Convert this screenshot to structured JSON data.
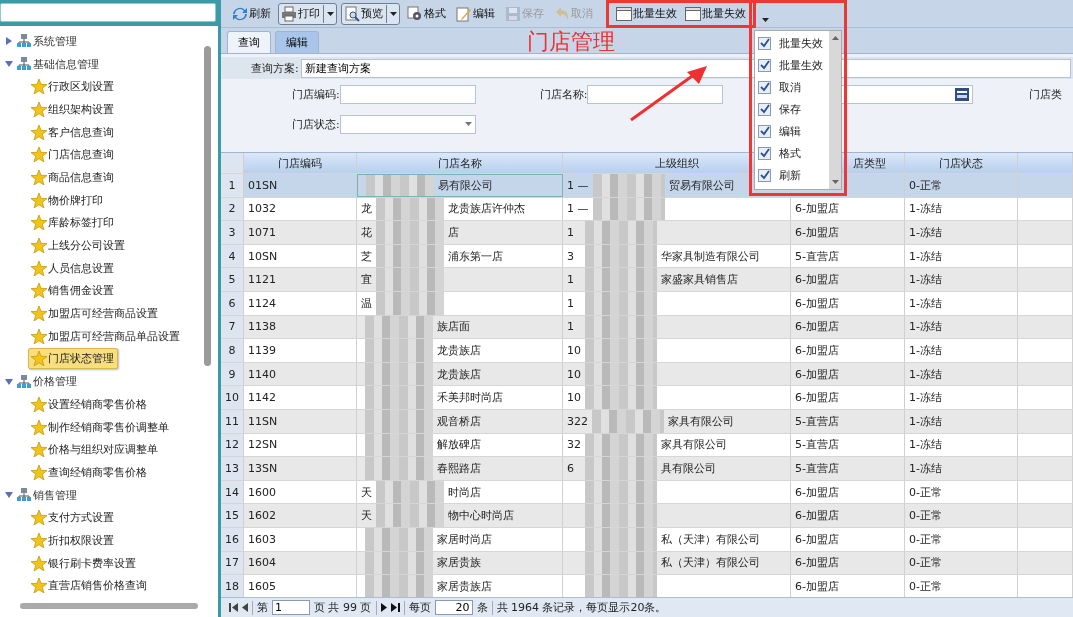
{
  "sidebar": {
    "tree": [
      {
        "label": "系统管理",
        "expanded": false
      },
      {
        "label": "基础信息管理",
        "expanded": true,
        "children": [
          {
            "label": "行政区划设置",
            "selected": false
          },
          {
            "label": "组织架构设置",
            "selected": false
          },
          {
            "label": "客户信息查询",
            "selected": false
          },
          {
            "label": "门店信息查询",
            "selected": false
          },
          {
            "label": "商品信息查询",
            "selected": false
          },
          {
            "label": "物价牌打印",
            "selected": false
          },
          {
            "label": "库龄标签打印",
            "selected": false
          },
          {
            "label": "上线分公司设置",
            "selected": false
          },
          {
            "label": "人员信息设置",
            "selected": false
          },
          {
            "label": "销售佣金设置",
            "selected": false
          },
          {
            "label": "加盟店可经营商品设置",
            "selected": false
          },
          {
            "label": "加盟店可经营商品单品设置",
            "selected": false
          },
          {
            "label": "门店状态管理",
            "selected": true
          }
        ]
      },
      {
        "label": "价格管理",
        "expanded": true,
        "children": [
          {
            "label": "设置经销商零售价格",
            "selected": false
          },
          {
            "label": "制作经销商零售价调整单",
            "selected": false
          },
          {
            "label": "价格与组织对应调整单",
            "selected": false
          },
          {
            "label": "查询经销商零售价格",
            "selected": false
          }
        ]
      },
      {
        "label": "销售管理",
        "expanded": true,
        "children": [
          {
            "label": "支付方式设置",
            "selected": false
          },
          {
            "label": "折扣权限设置",
            "selected": false
          },
          {
            "label": "银行刷卡费率设置",
            "selected": false
          },
          {
            "label": "直营店销售价格查询",
            "selected": false
          }
        ]
      }
    ]
  },
  "toolbar": [
    {
      "label": "刷新",
      "kind": "refresh",
      "disabled": false
    },
    {
      "label": "打印",
      "kind": "print",
      "disabled": false
    },
    {
      "label": "预览",
      "kind": "preview",
      "disabled": false
    },
    {
      "label": "格式",
      "kind": "format",
      "disabled": false
    },
    {
      "label": "编辑",
      "kind": "edit",
      "disabled": false
    },
    {
      "label": "保存",
      "kind": "save",
      "disabled": true
    },
    {
      "label": "取消",
      "kind": "cancel",
      "disabled": true
    },
    {
      "label": "批量生效",
      "kind": "batch",
      "disabled": false
    },
    {
      "label": "批量失效",
      "kind": "batch",
      "disabled": false
    }
  ],
  "overflow_menu": [
    {
      "label": "批量失效",
      "checked": true
    },
    {
      "label": "批量生效",
      "checked": true
    },
    {
      "label": "取消",
      "checked": true
    },
    {
      "label": "保存",
      "checked": true
    },
    {
      "label": "编辑",
      "checked": true
    },
    {
      "label": "格式",
      "checked": true
    },
    {
      "label": "刷新",
      "checked": true
    }
  ],
  "tabs": [
    {
      "label": "查询",
      "selected": false
    },
    {
      "label": "编辑",
      "selected": true
    }
  ],
  "query": {
    "scheme_label": "查询方案:",
    "scheme_value": "新建查询方案",
    "code_label": "门店编码:",
    "name_label": "门店名称:",
    "cut_label": "门店类",
    "status_label": "门店状态:"
  },
  "annotation": "门店管理",
  "table": {
    "columns": [
      "门店编码",
      "门店名称",
      "上级组织",
      "店类型",
      "门店状态"
    ],
    "rows": [
      {
        "num": "1",
        "code": "01SN",
        "name_head": "",
        "name_tail": "易有限公司",
        "org_head": "1 —",
        "org_tail": "贸易有限公司",
        "type": "",
        "status": "0-正常",
        "selected": true
      },
      {
        "num": "2",
        "code": "1032",
        "name_head": "龙",
        "name_tail": "龙贵族店许仲杰",
        "org_head": "1 —",
        "org_tail": "",
        "type": "6-加盟店",
        "status": "1-冻结",
        "selected": false
      },
      {
        "num": "3",
        "code": "1071",
        "name_head": "花",
        "name_tail": "店",
        "org_head": "1",
        "org_tail": "",
        "type": "6-加盟店",
        "status": "1-冻结",
        "selected": false
      },
      {
        "num": "4",
        "code": "10SN",
        "name_head": "芝",
        "name_tail": "浦东第一店",
        "org_head": "3",
        "org_tail": "华家具制造有限公司",
        "type": "5-直营店",
        "status": "1-冻结",
        "selected": false
      },
      {
        "num": "5",
        "code": "1121",
        "name_head": "宜",
        "name_tail": "",
        "org_head": "1",
        "org_tail": "家盛家具销售店",
        "type": "6-加盟店",
        "status": "1-冻结",
        "selected": false
      },
      {
        "num": "6",
        "code": "1124",
        "name_head": "温",
        "name_tail": "",
        "org_head": "1",
        "org_tail": "",
        "type": "6-加盟店",
        "status": "1-冻结",
        "selected": false
      },
      {
        "num": "7",
        "code": "1138",
        "name_head": "",
        "name_tail": "族店面",
        "org_head": "1",
        "org_tail": "",
        "type": "6-加盟店",
        "status": "1-冻结",
        "selected": false
      },
      {
        "num": "8",
        "code": "1139",
        "name_head": "",
        "name_tail": "龙贵族店",
        "org_head": "10",
        "org_tail": "",
        "type": "6-加盟店",
        "status": "1-冻结",
        "selected": false
      },
      {
        "num": "9",
        "code": "1140",
        "name_head": "",
        "name_tail": "龙贵族店",
        "org_head": "10",
        "org_tail": "",
        "type": "6-加盟店",
        "status": "1-冻结",
        "selected": false
      },
      {
        "num": "10",
        "code": "1142",
        "name_head": "",
        "name_tail": "禾美邦时尚店",
        "org_head": "10",
        "org_tail": "",
        "type": "6-加盟店",
        "status": "1-冻结",
        "selected": false
      },
      {
        "num": "11",
        "code": "11SN",
        "name_head": "",
        "name_tail": "观音桥店",
        "org_head": "322",
        "org_tail": "家具有限公司",
        "type": "5-直营店",
        "status": "1-冻结",
        "selected": false
      },
      {
        "num": "12",
        "code": "12SN",
        "name_head": "",
        "name_tail": "解放碑店",
        "org_head": "32",
        "org_tail": "家具有限公司",
        "type": "5-直营店",
        "status": "1-冻结",
        "selected": false
      },
      {
        "num": "13",
        "code": "13SN",
        "name_head": "",
        "name_tail": "春熙路店",
        "org_head": "6",
        "org_tail": "具有限公司",
        "type": "5-直营店",
        "status": "1-冻结",
        "selected": false
      },
      {
        "num": "14",
        "code": "1600",
        "name_head": "天",
        "name_tail": "时尚店",
        "org_head": "",
        "org_tail": "",
        "type": "6-加盟店",
        "status": "0-正常",
        "selected": false
      },
      {
        "num": "15",
        "code": "1602",
        "name_head": "天",
        "name_tail": "物中心时尚店",
        "org_head": "",
        "org_tail": "",
        "type": "6-加盟店",
        "status": "0-正常",
        "selected": false
      },
      {
        "num": "16",
        "code": "1603",
        "name_head": "",
        "name_tail": "家居时尚店",
        "org_head": "",
        "org_tail": "私（天津）有限公司",
        "type": "6-加盟店",
        "status": "0-正常",
        "selected": false
      },
      {
        "num": "17",
        "code": "1604",
        "name_head": "",
        "name_tail": "家居贵族",
        "org_head": "",
        "org_tail": "私（天津）有限公司",
        "type": "6-加盟店",
        "status": "0-正常",
        "selected": false
      },
      {
        "num": "18",
        "code": "1605",
        "name_head": "",
        "name_tail": "家居贵族店",
        "org_head": "",
        "org_tail": "",
        "type": "6-加盟店",
        "status": "0-正常",
        "selected": false
      }
    ]
  },
  "pager": {
    "page_prefix": "第",
    "page": "1",
    "page_suffix": "页 共 99 页",
    "per_label": "每页",
    "per": "20",
    "per_unit": "条",
    "summary": "共 1964 条记录，每页显示20条。"
  }
}
